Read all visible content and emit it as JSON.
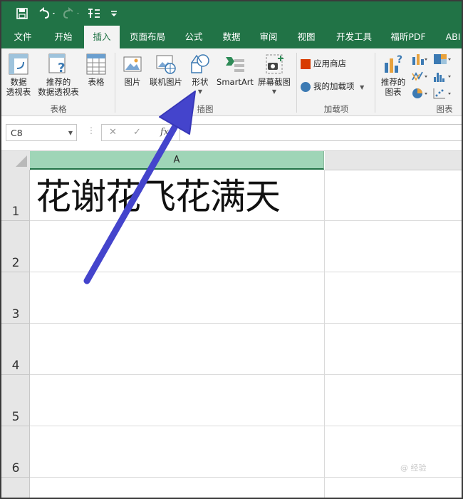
{
  "quick_access": {
    "save_icon": "save-icon",
    "undo_icon": "undo-icon",
    "redo_icon": "redo-icon",
    "form_icon": "form-icon",
    "customize_icon": "customize-icon"
  },
  "tabs": [
    {
      "label": "文件"
    },
    {
      "label": "开始"
    },
    {
      "label": "插入",
      "active": true
    },
    {
      "label": "页面布局"
    },
    {
      "label": "公式"
    },
    {
      "label": "数据"
    },
    {
      "label": "审阅"
    },
    {
      "label": "视图"
    },
    {
      "label": "开发工具"
    },
    {
      "label": "福昕PDF"
    },
    {
      "label": "ABI"
    }
  ],
  "ribbon": {
    "tables": {
      "pivot_l1": "数据",
      "pivot_l2": "透视表",
      "rec_pivot_l1": "推荐的",
      "rec_pivot_l2": "数据透视表",
      "table": "表格",
      "group": "表格"
    },
    "illustrations": {
      "pictures": "图片",
      "online_pictures": "联机图片",
      "shapes": "形状",
      "smartart": "SmartArt",
      "screenshot": "屏幕截图",
      "group": "插图"
    },
    "addins": {
      "store": "应用商店",
      "my_addins": "我的加载项",
      "group": "加载项"
    },
    "charts": {
      "rec_l1": "推荐的",
      "rec_l2": "图表",
      "group": "图表"
    }
  },
  "formula_bar": {
    "name_box": "C8",
    "cancel": "✕",
    "enter": "✓",
    "fx": "fx",
    "value": ""
  },
  "sheet": {
    "columns": [
      "A"
    ],
    "rows": [
      "1",
      "2",
      "3",
      "4",
      "5",
      "6"
    ],
    "cells": {
      "A1": "花谢花飞花满天"
    }
  },
  "annotation": {
    "arrow_color": "#4444cc"
  },
  "watermark": "@ 经验"
}
